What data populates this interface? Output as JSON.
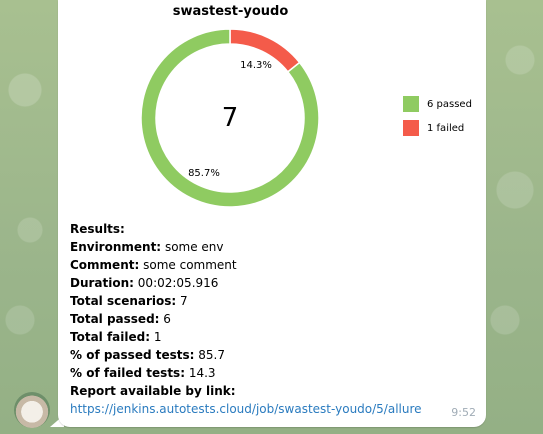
{
  "message": {
    "time": "9:52",
    "results": {
      "heading": "Results:",
      "lines": [
        {
          "label": "Environment:",
          "value": "some env"
        },
        {
          "label": "Comment:",
          "value": "some comment"
        },
        {
          "label": "Duration:",
          "value": "00:02:05.916"
        },
        {
          "label": "Total scenarios:",
          "value": "7"
        },
        {
          "label": "Total passed:",
          "value": "6"
        },
        {
          "label": "Total failed:",
          "value": "1"
        },
        {
          "label": "% of passed tests:",
          "value": "85.7"
        },
        {
          "label": "% of failed tests:",
          "value": "14.3"
        }
      ],
      "link_label": "Report available by link:",
      "link": "https://jenkins.autotests.cloud/job/swastest-youdo/5/allure"
    }
  },
  "chart_data": {
    "type": "pie",
    "title": "swastest-youdo",
    "center_label": "7",
    "slices": [
      {
        "label": "6 passed",
        "value": 6,
        "pct_label": "85.7%",
        "color": "#8fcb61"
      },
      {
        "label": "1 failed",
        "value": 1,
        "pct_label": "14.3%",
        "color": "#f45b4a"
      }
    ],
    "legend_position": "right"
  },
  "colors": {
    "link": "#2a7bbf",
    "time": "#a0acb6"
  }
}
